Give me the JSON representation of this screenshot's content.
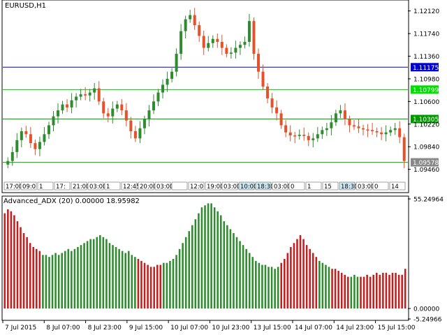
{
  "header": {
    "symbol": "EURUSD,H1"
  },
  "indicator": {
    "label": "Advanced_ADX (20) 0.00000 18.95982"
  },
  "colors": {
    "bull": "#2e8b2e",
    "bear": "#e4512b",
    "adx_up": "#2e8b2e",
    "adx_down": "#c41e1e",
    "hline_blue": "#0000cc",
    "hline_green": "#00cc00",
    "axis": "#000000"
  },
  "chart_data": [
    {
      "type": "candlestick",
      "title": "EURUSD,H1",
      "ylim": [
        1.0928,
        1.1228
      ],
      "y_ticks": [
        "1.12120",
        "1.11740",
        "1.11360",
        "1.10980",
        "1.10600",
        "1.10220",
        "1.09840",
        "1.09460"
      ],
      "y_tick_values": [
        1.1212,
        1.1174,
        1.1136,
        1.1098,
        1.106,
        1.1022,
        1.0984,
        1.0946
      ],
      "hlines": [
        {
          "label": "1.11175",
          "value": 1.11175,
          "color": "#0000cc",
          "badge_bg": "#0000cc",
          "badge_fg": "#ffffff"
        },
        {
          "label": "1.10799",
          "value": 1.10799,
          "color": "#00cc00",
          "badge_bg": "#00dd00",
          "badge_fg": "#ffffff"
        },
        {
          "label": "1.10305",
          "value": 1.10305,
          "color": "#00aa00",
          "badge_bg": "#009900",
          "badge_fg": "#ffffff"
        },
        {
          "label": "1.09578",
          "value": 1.09578,
          "color": "#00aa00",
          "badge_bg": "#888888",
          "badge_fg": "#ffffff"
        }
      ],
      "time_labels": [
        "17:00",
        "09:0",
        "1",
        "17:",
        "21:00",
        "03:00",
        "1",
        "12:45",
        "20:00",
        "03:00",
        "",
        "12:0",
        "19:00",
        "03:00",
        "10:00",
        "18:30",
        "03:00",
        "0",
        "1",
        "15",
        "18:30",
        "03:00",
        "0",
        "14"
      ],
      "closes": [
        1.096,
        1.0975,
        1.0995,
        1.101,
        1.1005,
        1.099,
        1.098,
        1.0992,
        1.1005,
        1.102,
        1.1035,
        1.1045,
        1.1055,
        1.105,
        1.1062,
        1.1068,
        1.1072,
        1.107,
        1.1075,
        1.1082,
        1.106,
        1.104,
        1.1035,
        1.1048,
        1.1055,
        1.1045,
        1.1028,
        1.101,
        1.0998,
        1.1015,
        1.103,
        1.1045,
        1.106,
        1.1075,
        1.1088,
        1.1098,
        1.111,
        1.114,
        1.1178,
        1.1198,
        1.1205,
        1.1188,
        1.117,
        1.115,
        1.1158,
        1.1165,
        1.116,
        1.115,
        1.114,
        1.1142,
        1.115,
        1.1155,
        1.116,
        1.1195,
        1.114,
        1.111,
        1.1085,
        1.1065,
        1.105,
        1.104,
        1.102,
        1.1008,
        1.1003,
        1.1002,
        1.1004,
        1.1002,
        1.0995,
        1.0998,
        1.1005,
        1.1012,
        1.1015,
        1.1025,
        1.104,
        1.1045,
        1.103,
        1.102,
        1.1018,
        1.1015,
        1.1013,
        1.1012,
        1.101,
        1.1008,
        1.1005,
        1.1008,
        1.1012,
        1.1015,
        1.1,
        1.096
      ]
    },
    {
      "type": "bar",
      "title": "Advanced_ADX (20) 0.00000 18.95982",
      "ylim": [
        -5.24966,
        55.24964
      ],
      "y_ticks": [
        "55.24964",
        "0.00000",
        "-5.24966"
      ],
      "y_tick_values": [
        55.24964,
        0.0,
        -5.24966
      ],
      "x_labels": [
        "7 Jul 2015",
        "8 Jul 07:00",
        "8 Jul 23:00",
        "9 Jul 15:00",
        "10 Jul 07:00",
        "10 Jul 23:00",
        "13 Jul 15:00",
        "14 Jul 07:00",
        "14 Jul 23:00",
        "15 Jul 15:00"
      ],
      "values": [
        48,
        50,
        49,
        47,
        44,
        41,
        38,
        36,
        33,
        31,
        30,
        29,
        27,
        27,
        26,
        27,
        28,
        27,
        28,
        29,
        30,
        29,
        30,
        31,
        32,
        33,
        34,
        35,
        35,
        36,
        37,
        36,
        35,
        33,
        32,
        31,
        30,
        29,
        28,
        29,
        27,
        26,
        25,
        24,
        23,
        22,
        21,
        21,
        22,
        22,
        23,
        23,
        24,
        25,
        27,
        30,
        33,
        36,
        39,
        42,
        45,
        48,
        51,
        52,
        53,
        53,
        51,
        49,
        47,
        44,
        42,
        40,
        38,
        36,
        34,
        32,
        30,
        28,
        26,
        24,
        23,
        22,
        22,
        21,
        21,
        20,
        21,
        23,
        25,
        28,
        31,
        33,
        35,
        37,
        35,
        32,
        30,
        28,
        26,
        24,
        23,
        22,
        21,
        20,
        20,
        19,
        18,
        17,
        16,
        16,
        17,
        16,
        16,
        16,
        17,
        16,
        17,
        18,
        17,
        18,
        18,
        17,
        18,
        18,
        17,
        17,
        20
      ],
      "signal": [
        1,
        1,
        1,
        1,
        1,
        1,
        1,
        1,
        1,
        1,
        1,
        1,
        0,
        0,
        0,
        0,
        0,
        0,
        0,
        0,
        0,
        0,
        0,
        0,
        0,
        0,
        0,
        0,
        0,
        0,
        0,
        0,
        0,
        0,
        0,
        0,
        0,
        0,
        0,
        0,
        0,
        0,
        1,
        1,
        1,
        1,
        1,
        1,
        1,
        1,
        0,
        0,
        0,
        0,
        0,
        0,
        0,
        0,
        0,
        0,
        0,
        0,
        0,
        0,
        0,
        0,
        0,
        0,
        0,
        0,
        0,
        0,
        0,
        0,
        0,
        0,
        0,
        0,
        0,
        0,
        0,
        0,
        0,
        0,
        0,
        0,
        0,
        1,
        1,
        1,
        1,
        1,
        1,
        1,
        1,
        1,
        1,
        1,
        1,
        0,
        0,
        0,
        0,
        1,
        1,
        1,
        1,
        1,
        1,
        0,
        0,
        0,
        1,
        1,
        1,
        1,
        1,
        1,
        1,
        1,
        1,
        1,
        1,
        1,
        1,
        1,
        1
      ]
    }
  ]
}
